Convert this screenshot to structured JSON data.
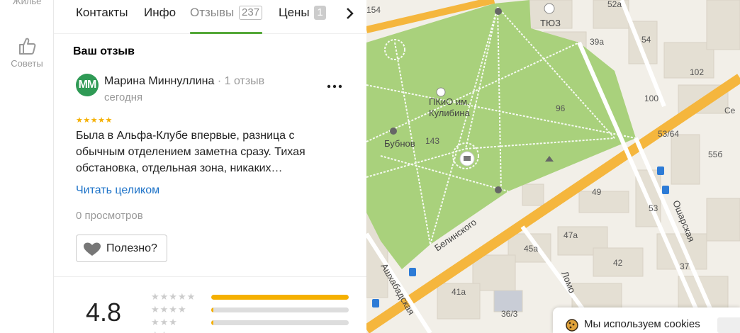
{
  "rail": {
    "housing_label": "Жильё",
    "tips_label": "Советы"
  },
  "tabs": [
    {
      "label": "Контакты"
    },
    {
      "label": "Инфо"
    },
    {
      "label": "Отзывы",
      "count": "237"
    },
    {
      "label": "Цены",
      "count": "1"
    }
  ],
  "your_review_title": "Ваш отзыв",
  "review": {
    "avatar_initials": "ММ",
    "author": "Марина Миннуллина",
    "author_reviews": "1 отзыв",
    "date": "сегодня",
    "rating": 5,
    "stars_text": "★★★★★",
    "text": "Была в Альфа-Клубе впервые, разница с обычным отделением заметна сразу. Тихая обстановка, отдельная зона, никаких…",
    "read_more": "Читать целиком",
    "views": "0 просмотров",
    "useful_label": "Полезно?"
  },
  "summary": {
    "rating": "4.8",
    "distribution": [
      {
        "stars": 5,
        "stars_text": "★★★★★",
        "fraction": 1.0
      },
      {
        "stars": 4,
        "stars_text": "★★★★",
        "fraction": 0.01
      },
      {
        "stars": 3,
        "stars_text": "★★★",
        "fraction": 0.01
      },
      {
        "stars": 2,
        "stars_text": "★★",
        "fraction": 0.0
      }
    ]
  },
  "map": {
    "labels": {
      "tyuz": "ТЮЗ",
      "park": "ПКиО им.",
      "park2": "Кулибина",
      "bubnov": "Бубнов",
      "belinskogo": "Белинского",
      "ashkhabadskaya": "Ашхабадская",
      "osharskaya": "Ошарская",
      "lomonosov": "Ломо"
    },
    "house_numbers": {
      "n154": "154",
      "n52a": "52а",
      "n39a": "39а",
      "n54": "54",
      "n102": "102",
      "n100": "100",
      "n96": "96",
      "n143": "143",
      "n5364": "53/64",
      "n556": "55б",
      "n49": "49",
      "n53": "53",
      "n47a": "47а",
      "n45a": "45а",
      "n42": "42",
      "n41a": "41а",
      "n363": "36/3",
      "n37": "37",
      "ce": "Се"
    },
    "colors": {
      "park": "#a9d17c",
      "road": "#f5b63d",
      "building": "#e4dfd3",
      "base": "#f2efe8"
    }
  },
  "cookie": {
    "text": "Мы используем cookies"
  }
}
